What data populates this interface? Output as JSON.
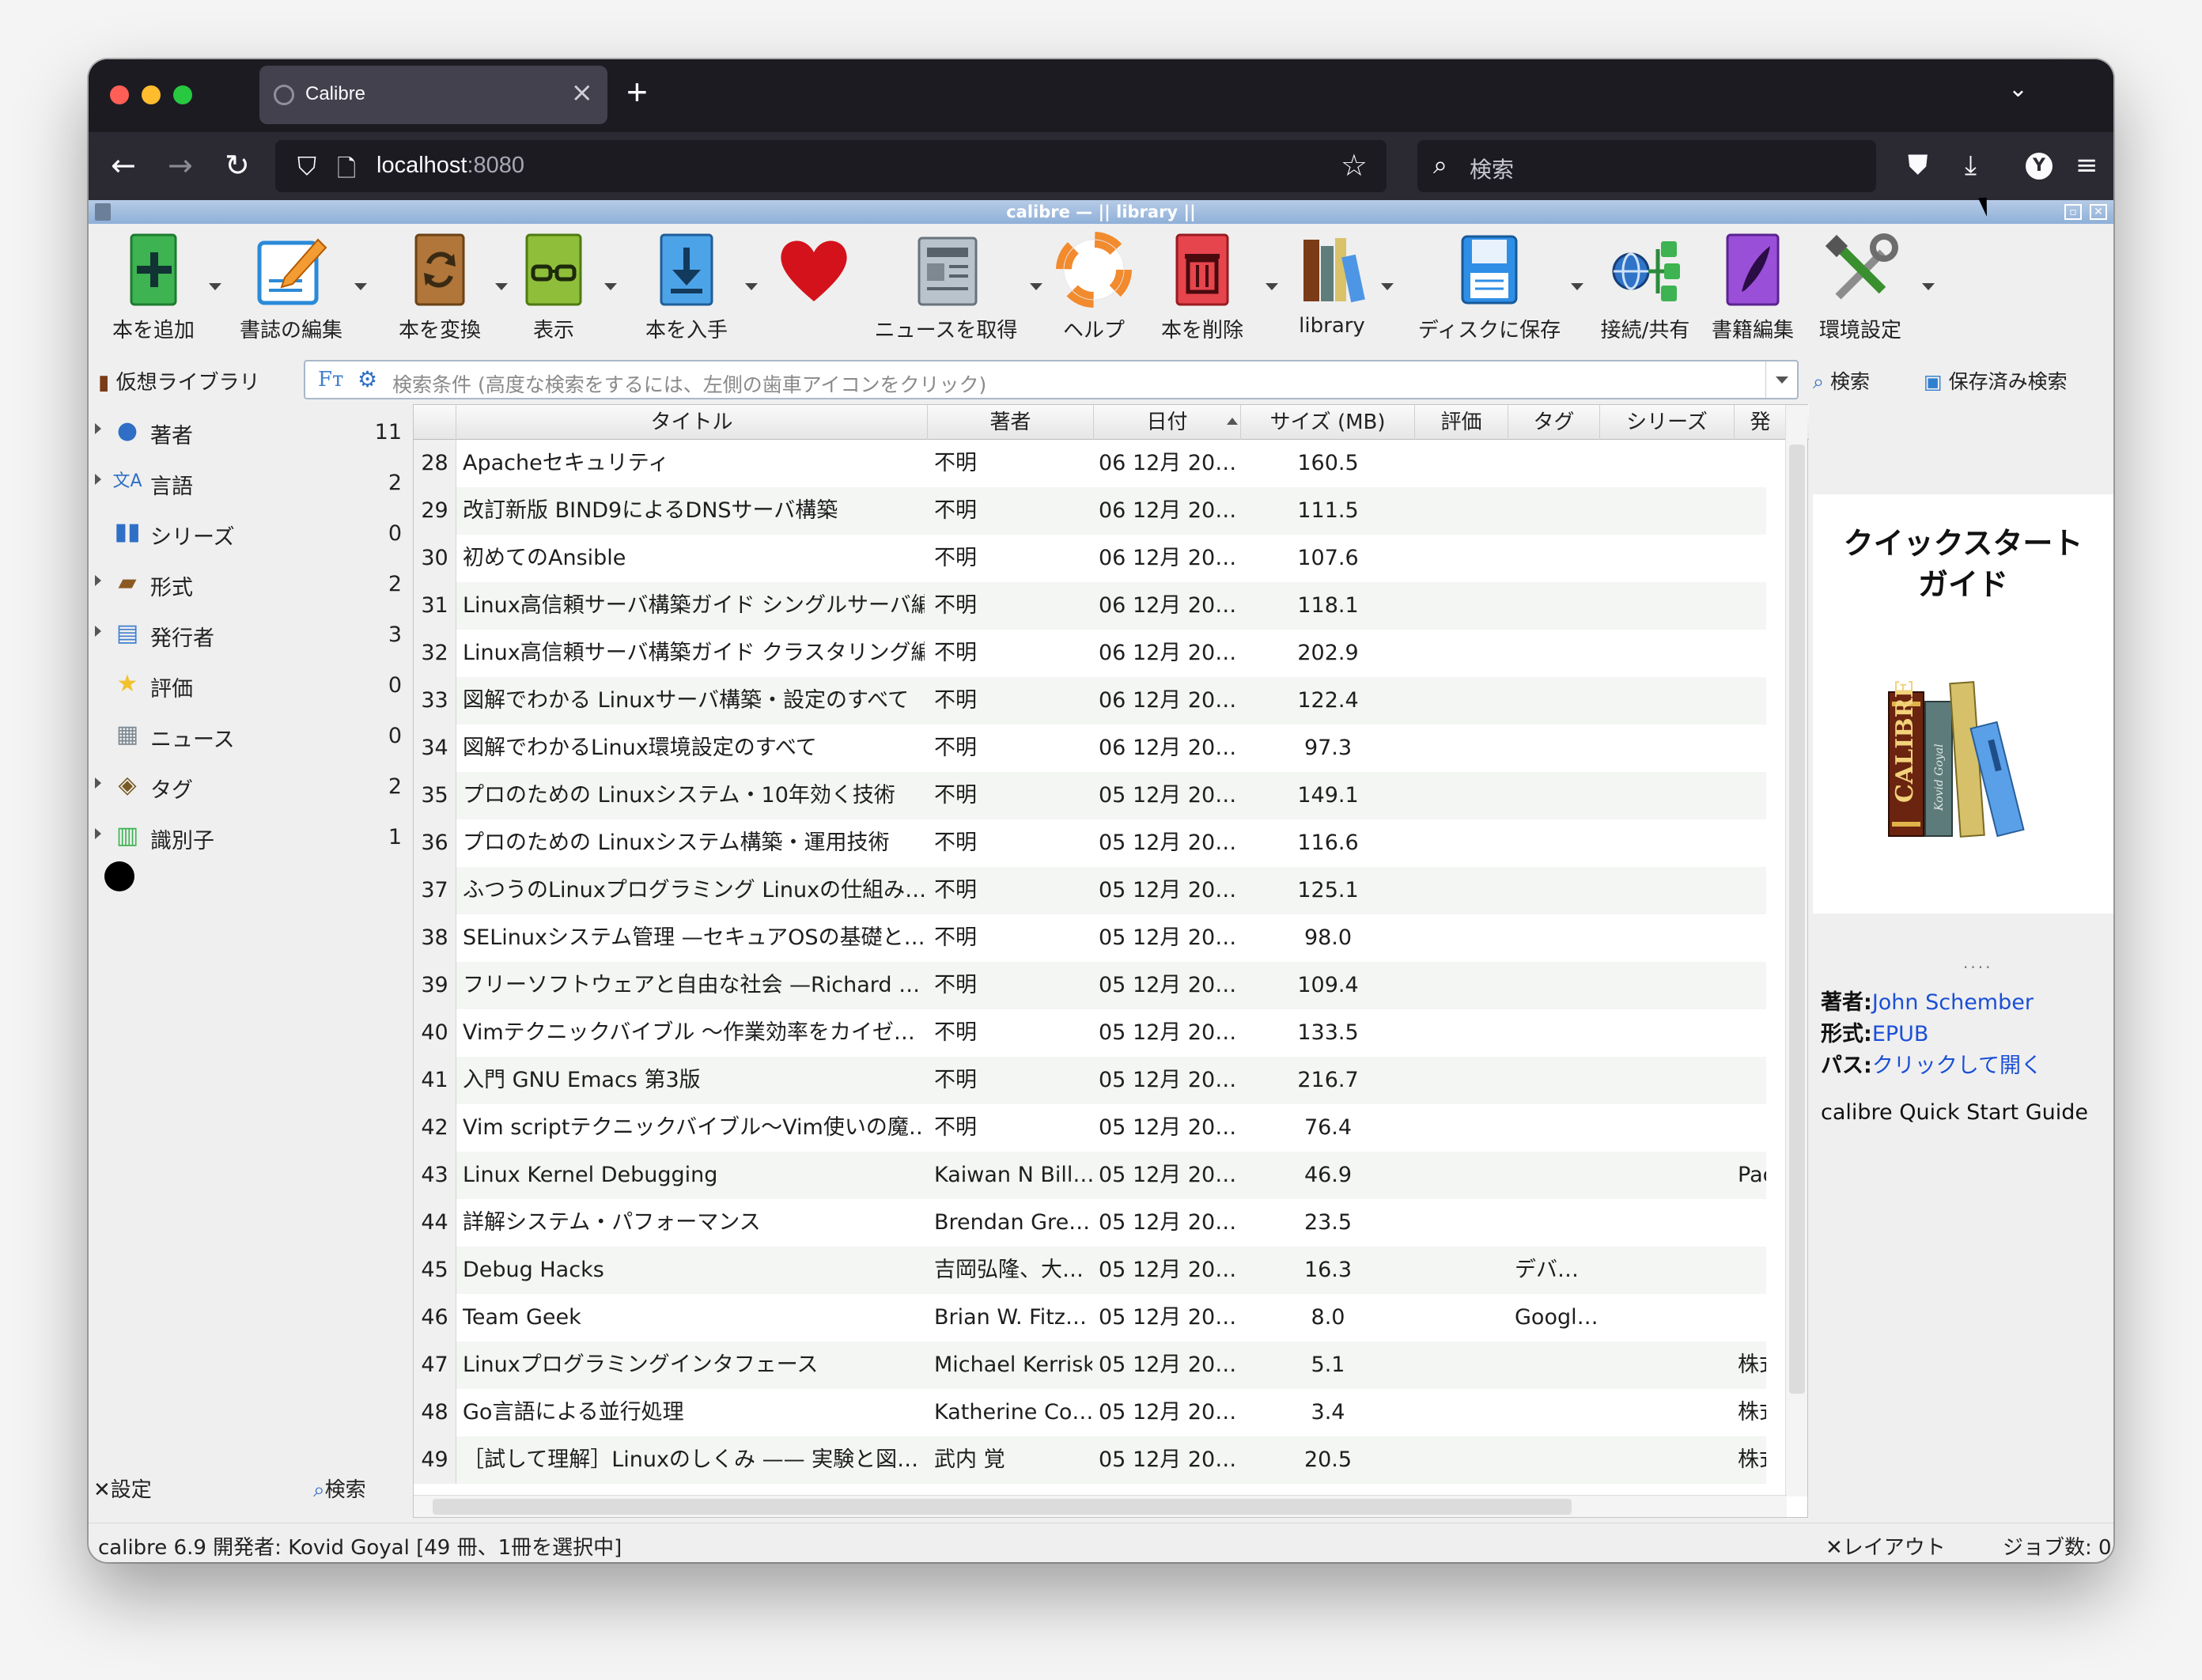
{
  "browser": {
    "tab_title": "Calibre",
    "url_host": "localhost",
    "url_port": ":8080",
    "search_placeholder": "検索",
    "profile_initial": "Y"
  },
  "app": {
    "window_title": "calibre — || library ||",
    "toolbar": [
      {
        "label": "本を追加",
        "icon": "add-book-icon"
      },
      {
        "label": "書誌の編集",
        "icon": "edit-metadata-icon"
      },
      {
        "label": "本を変換",
        "icon": "convert-book-icon"
      },
      {
        "label": "表示",
        "icon": "view-icon"
      },
      {
        "label": "本を入手",
        "icon": "get-books-icon"
      },
      {
        "label": "",
        "icon": "heart-icon"
      },
      {
        "label": "ニュースを取得",
        "icon": "news-icon"
      },
      {
        "label": "ヘルプ",
        "icon": "help-icon"
      },
      {
        "label": "本を削除",
        "icon": "remove-book-icon"
      },
      {
        "label": "library",
        "icon": "library-icon"
      },
      {
        "label": "ディスクに保存",
        "icon": "save-to-disk-icon"
      },
      {
        "label": "接続/共有",
        "icon": "connect-share-icon"
      },
      {
        "label": "書籍編集",
        "icon": "edit-book-icon"
      },
      {
        "label": "環境設定",
        "icon": "preferences-icon"
      }
    ],
    "virtual_library": "仮想ライブラリ",
    "search_placeholder": "検索条件 (高度な検索をするには、左側の歯車アイコンをクリック)",
    "search_button": "検索",
    "saved_search_button": "保存済み検索",
    "categories": [
      {
        "label": "著者",
        "count": "11",
        "icon": "person-icon"
      },
      {
        "label": "言語",
        "count": "2",
        "icon": "language-icon"
      },
      {
        "label": "シリーズ",
        "count": "0",
        "icon": "series-icon"
      },
      {
        "label": "形式",
        "count": "2",
        "icon": "format-icon"
      },
      {
        "label": "発行者",
        "count": "3",
        "icon": "publisher-icon"
      },
      {
        "label": "評価",
        "count": "0",
        "icon": "star-icon"
      },
      {
        "label": "ニュース",
        "count": "0",
        "icon": "news-icon"
      },
      {
        "label": "タグ",
        "count": "2",
        "icon": "tag-icon"
      },
      {
        "label": "識別子",
        "count": "1",
        "icon": "barcode-icon"
      }
    ],
    "left_footer": {
      "settings": "設定",
      "search": "検索"
    },
    "columns": [
      "タイトル",
      "著者",
      "日付",
      "サイズ (MB)",
      "評価",
      "タグ",
      "シリーズ",
      "発"
    ],
    "rows": [
      {
        "n": "28",
        "title": "Apacheセキュリティ",
        "author": "不明",
        "date": "06 12月 20…",
        "size": "160.5",
        "tags": "",
        "pub": ""
      },
      {
        "n": "29",
        "title": "改訂新版 BIND9によるDNSサーバ構築",
        "author": "不明",
        "date": "06 12月 20…",
        "size": "111.5",
        "tags": "",
        "pub": ""
      },
      {
        "n": "30",
        "title": "初めてのAnsible",
        "author": "不明",
        "date": "06 12月 20…",
        "size": "107.6",
        "tags": "",
        "pub": ""
      },
      {
        "n": "31",
        "title": "Linux高信頼サーバ構築ガイド シングルサーバ編",
        "author": "不明",
        "date": "06 12月 20…",
        "size": "118.1",
        "tags": "",
        "pub": ""
      },
      {
        "n": "32",
        "title": "Linux高信頼サーバ構築ガイド クラスタリング編",
        "author": "不明",
        "date": "06 12月 20…",
        "size": "202.9",
        "tags": "",
        "pub": ""
      },
      {
        "n": "33",
        "title": "図解でわかる Linuxサーバ構築・設定のすべて",
        "author": "不明",
        "date": "06 12月 20…",
        "size": "122.4",
        "tags": "",
        "pub": ""
      },
      {
        "n": "34",
        "title": "図解でわかるLinux環境設定のすべて",
        "author": "不明",
        "date": "06 12月 20…",
        "size": "97.3",
        "tags": "",
        "pub": ""
      },
      {
        "n": "35",
        "title": "プロのための Linuxシステム・10年効く技術",
        "author": "不明",
        "date": "05 12月 20…",
        "size": "149.1",
        "tags": "",
        "pub": ""
      },
      {
        "n": "36",
        "title": "プロのための Linuxシステム構築・運用技術",
        "author": "不明",
        "date": "05 12月 20…",
        "size": "116.6",
        "tags": "",
        "pub": ""
      },
      {
        "n": "37",
        "title": "ふつうのLinuxプログラミング Linuxの仕組み…",
        "author": "不明",
        "date": "05 12月 20…",
        "size": "125.1",
        "tags": "",
        "pub": ""
      },
      {
        "n": "38",
        "title": "SELinuxシステム管理 —セキュアOSの基礎と…",
        "author": "不明",
        "date": "05 12月 20…",
        "size": "98.0",
        "tags": "",
        "pub": ""
      },
      {
        "n": "39",
        "title": "フリーソフトウェアと自由な社会 —Richard …",
        "author": "不明",
        "date": "05 12月 20…",
        "size": "109.4",
        "tags": "",
        "pub": ""
      },
      {
        "n": "40",
        "title": "Vimテクニックバイブル ～作業効率をカイゼ…",
        "author": "不明",
        "date": "05 12月 20…",
        "size": "133.5",
        "tags": "",
        "pub": ""
      },
      {
        "n": "41",
        "title": "入門 GNU Emacs 第3版",
        "author": "不明",
        "date": "05 12月 20…",
        "size": "216.7",
        "tags": "",
        "pub": ""
      },
      {
        "n": "42",
        "title": "Vim scriptテクニックバイブル～Vim使いの魔…",
        "author": "不明",
        "date": "05 12月 20…",
        "size": "76.4",
        "tags": "",
        "pub": ""
      },
      {
        "n": "43",
        "title": "Linux Kernel Debugging",
        "author": "Kaiwan N Bill…",
        "date": "05 12月 20…",
        "size": "46.9",
        "tags": "",
        "pub": "Pac"
      },
      {
        "n": "44",
        "title": "詳解システム・パフォーマンス",
        "author": "Brendan Gre…",
        "date": "05 12月 20…",
        "size": "23.5",
        "tags": "",
        "pub": ""
      },
      {
        "n": "45",
        "title": "Debug Hacks",
        "author": "吉岡弘隆、大…",
        "date": "05 12月 20…",
        "size": "16.3",
        "tags": "デバ…",
        "pub": ""
      },
      {
        "n": "46",
        "title": "Team Geek",
        "author": "Brian W. Fitz…",
        "date": "05 12月 20…",
        "size": "8.0",
        "tags": "Googl…",
        "pub": ""
      },
      {
        "n": "47",
        "title": "Linuxプログラミングインタフェース",
        "author": "Michael Kerrisk",
        "date": "05 12月 20…",
        "size": "5.1",
        "tags": "",
        "pub": "株式"
      },
      {
        "n": "48",
        "title": "Go言語による並行処理",
        "author": "Katherine Co…",
        "date": "05 12月 20…",
        "size": "3.4",
        "tags": "",
        "pub": "株式"
      },
      {
        "n": "49",
        "title": "［試して理解］Linuxのしくみ —— 実験と図…",
        "author": "武内 覚",
        "date": "05 12月 20…",
        "size": "20.5",
        "tags": "",
        "pub": "株式"
      }
    ],
    "details": {
      "cover_title": "クイックスタート\nガイド",
      "cover_spine_1": "CALIBRE",
      "cover_spine_2": "Kovid Goyal",
      "author_label": "著者:",
      "author_value": "John Schember",
      "format_label": "形式:",
      "format_value": "EPUB",
      "path_label": "パス:",
      "path_value": "クリックして開く",
      "description": "calibre Quick Start Guide"
    },
    "status": {
      "left": "calibre 6.9 開発者:  Kovid Goyal    [49 冊、1冊を選択中]",
      "layout": "レイアウト",
      "jobs": "ジョブ数: 0"
    }
  }
}
